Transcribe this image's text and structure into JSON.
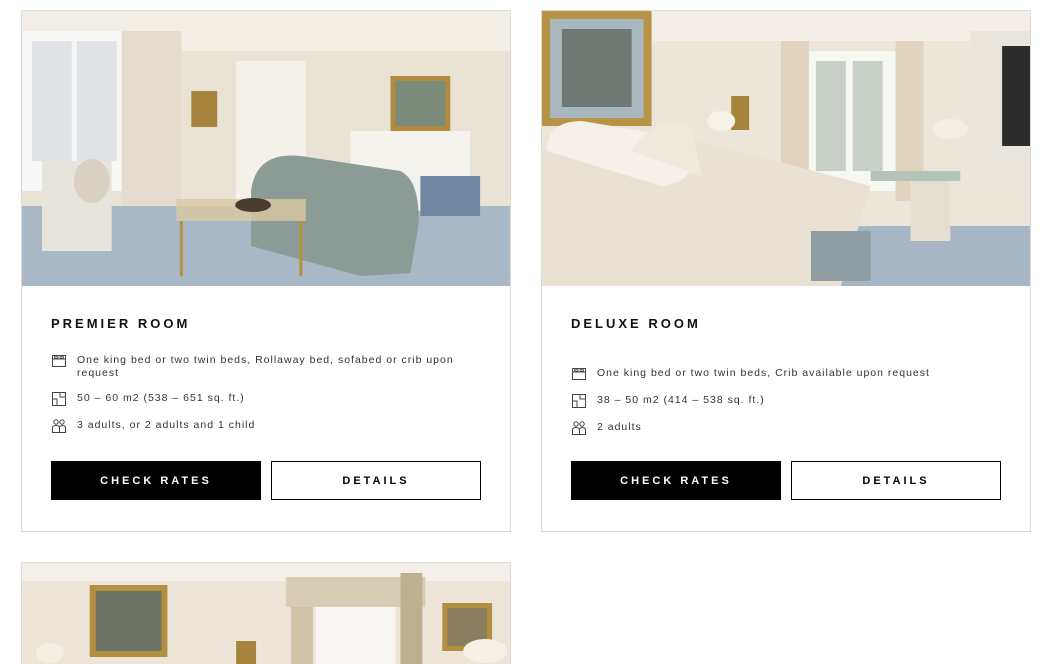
{
  "rooms": [
    {
      "name": "PREMIER ROOM",
      "features": [
        {
          "icon": "bed-icon",
          "text": "One king bed or two twin beds, Rollaway bed, sofabed or crib upon request"
        },
        {
          "icon": "floor-plan-icon",
          "text": "50 – 60 m2 (538 – 651 sq. ft.)"
        },
        {
          "icon": "guests-icon",
          "text": "3 adults, or 2 adults and 1 child"
        }
      ],
      "primary_label": "CHECK RATES",
      "secondary_label": "DETAILS"
    },
    {
      "name": "DELUXE ROOM",
      "features": [
        {
          "icon": "bed-icon",
          "text": "One king bed or two twin beds, Crib available upon request"
        },
        {
          "icon": "floor-plan-icon",
          "text": "38 – 50 m2 (414 – 538 sq. ft.)"
        },
        {
          "icon": "guests-icon",
          "text": "2 adults"
        }
      ],
      "primary_label": "CHECK RATES",
      "secondary_label": "DETAILS"
    }
  ],
  "colors": {
    "primary_button": "#000000",
    "card_border": "#dcdcdc"
  }
}
